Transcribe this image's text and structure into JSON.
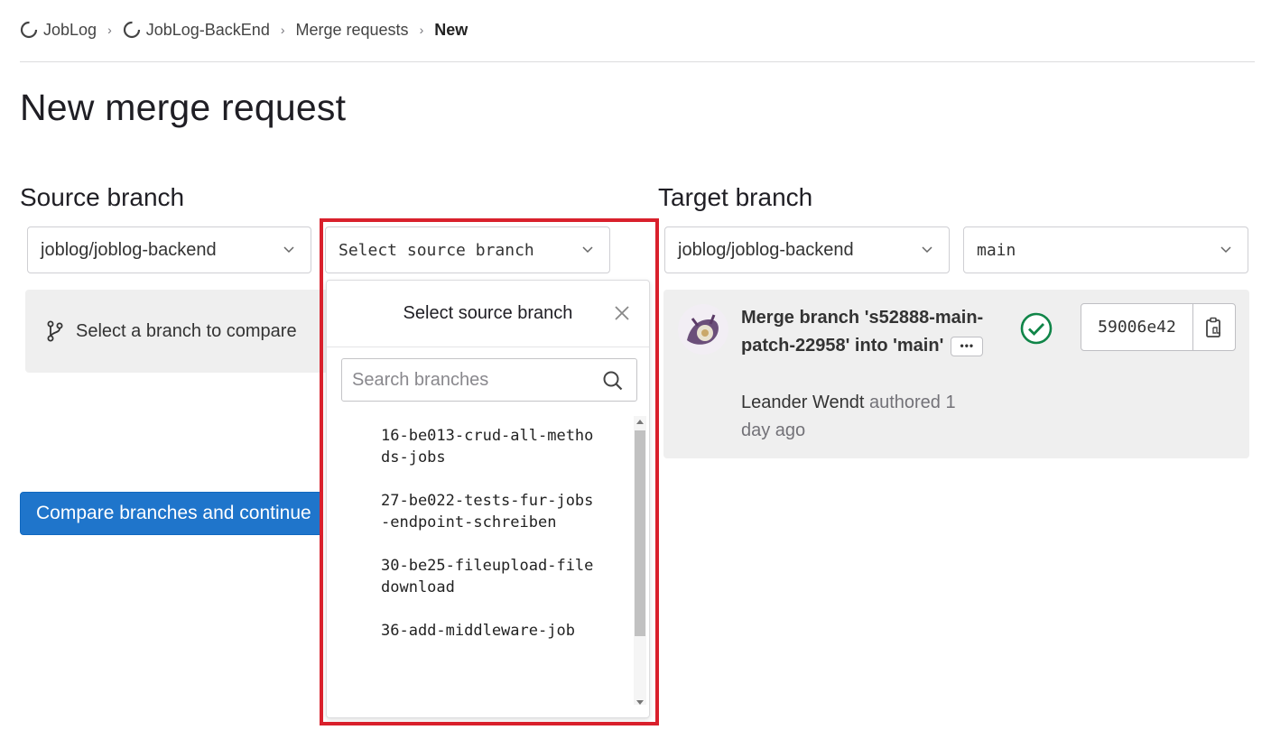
{
  "breadcrumb": {
    "items": [
      {
        "label": "JobLog",
        "icon": "project-icon"
      },
      {
        "label": "JobLog-BackEnd",
        "icon": "project-icon"
      },
      {
        "label": "Merge requests"
      },
      {
        "label": "New"
      }
    ]
  },
  "page": {
    "title": "New merge request"
  },
  "source": {
    "heading": "Source branch",
    "project_select": "joblog/joblog-backend",
    "branch_select": "Select source branch",
    "compare_hint": "Select a branch to compare",
    "compare_button": "Compare branches and continue"
  },
  "target": {
    "heading": "Target branch",
    "project_select": "joblog/joblog-backend",
    "branch_select": "main"
  },
  "dropdown": {
    "title": "Select source branch",
    "search_placeholder": "Search branches",
    "branches": [
      "16-be013-crud-all-methods-jobs",
      "27-be022-tests-fur-jobs-endpoint-schreiben",
      "30-be25-fileupload-filedownload",
      "36-add-middleware-job"
    ]
  },
  "commit": {
    "title": "Merge branch 's52888-main-patch-22958' into 'main'",
    "ellipsis": "•••",
    "author": "Leander Wendt",
    "authored_text": "authored 1 day ago",
    "sha": "59006e42",
    "status": "passed"
  },
  "colors": {
    "primary": "#1f75cb",
    "highlight": "#d9202c",
    "success": "#108548"
  }
}
